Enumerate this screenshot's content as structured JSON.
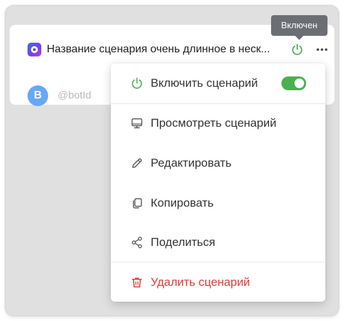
{
  "card": {
    "title": "Название сценария очень длинное в неск...",
    "avatar_letter": "B",
    "bot_id": "@botId",
    "power_icon": "power-icon",
    "more_icon": "more-horizontal-icon"
  },
  "tooltip": {
    "text": "Включен"
  },
  "menu": {
    "enable": {
      "label": "Включить сценарий",
      "icon": "power-icon",
      "toggle_on": true
    },
    "items": [
      {
        "label": "Просмотреть сценарий",
        "icon": "monitor-icon"
      },
      {
        "label": "Редактировать",
        "icon": "pencil-icon"
      },
      {
        "label": "Копировать",
        "icon": "copy-icon"
      },
      {
        "label": "Поделиться",
        "icon": "share-icon"
      }
    ],
    "delete": {
      "label": "Удалить сценарий",
      "icon": "trash-icon"
    }
  },
  "colors": {
    "accent_green": "#4caf50",
    "danger_red": "#e53935",
    "tooltip_bg": "#6b6f73",
    "avatar_bg": "#67a7f6"
  }
}
